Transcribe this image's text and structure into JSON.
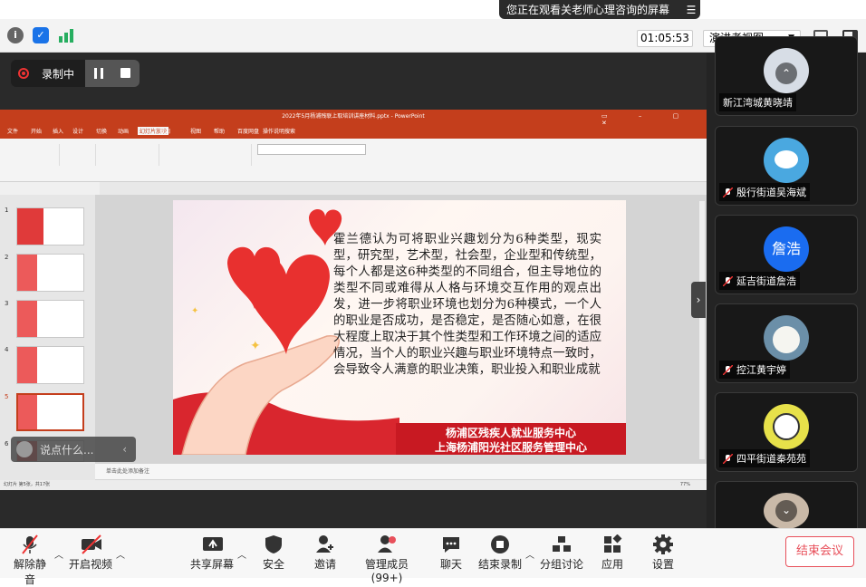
{
  "status": {
    "viewing_text": "您正在观看关老师心理咨询的屏幕",
    "timer": "01:05:53",
    "presenter_view": "演讲者视图"
  },
  "recording": {
    "label": "录制中"
  },
  "ppt": {
    "window_title": "2022年5月杨浦残联上取培训讲座材料.pptx - PowerPoint",
    "menu_items": [
      "文件",
      "开始",
      "插入",
      "设计",
      "切换",
      "动画",
      "幻灯片放映",
      "审阅",
      "视图",
      "帮助",
      "百度网盘",
      "操作说明搜索"
    ],
    "thumb_numbers": [
      "1",
      "2",
      "3",
      "4",
      "5",
      "6"
    ],
    "notes_placeholder": "单击此处添加备注",
    "status_left": "幻灯片 第5张，共17张",
    "zoom": "77%"
  },
  "slide": {
    "body": "霍兰德认为可将职业兴趣划分为6种类型，现实型，研究型，艺术型，社会型，企业型和传统型，每个人都是这6种类型的不同组合，但主导地位的类型不同或难得从人格与环境交互作用的观点出发，进一步将职业环境也划分为6种模式，一个人的职业是否成功，是否稳定，是否随心如意，在很大程度上取决于其个性类型和工作环境之间的适应情况，当个人的职业兴趣与职业环境特点一致时，会导致令人满意的职业决策，职业投入和职业成就",
    "banner_line1": "杨浦区残疾人就业服务中心",
    "banner_line2": "上海杨浦阳光社区服务管理中心"
  },
  "chat": {
    "placeholder": "说点什么..."
  },
  "participants": [
    {
      "name": "新江湾城黄晓靖",
      "avatar_text": ""
    },
    {
      "name": "殷行街道吴海斌",
      "avatar_text": ""
    },
    {
      "name": "延吉街道詹浩",
      "avatar_text": "詹浩"
    },
    {
      "name": "控江黄宇婷",
      "avatar_text": ""
    },
    {
      "name": "四平街道秦苑苑",
      "avatar_text": ""
    }
  ],
  "toolbar": {
    "unmute": "解除静音",
    "video": "开启视频",
    "share": "共享屏幕",
    "security": "安全",
    "invite": "邀请",
    "members": "管理成员(99+)",
    "chat": "聊天",
    "end_recording": "结束录制",
    "breakout": "分组讨论",
    "apps": "应用",
    "settings": "设置",
    "end_meeting": "结束会议"
  },
  "colors": {
    "ppt_red": "#c43e1c",
    "banner_red": "#c81922",
    "end_red": "#e8505b"
  }
}
